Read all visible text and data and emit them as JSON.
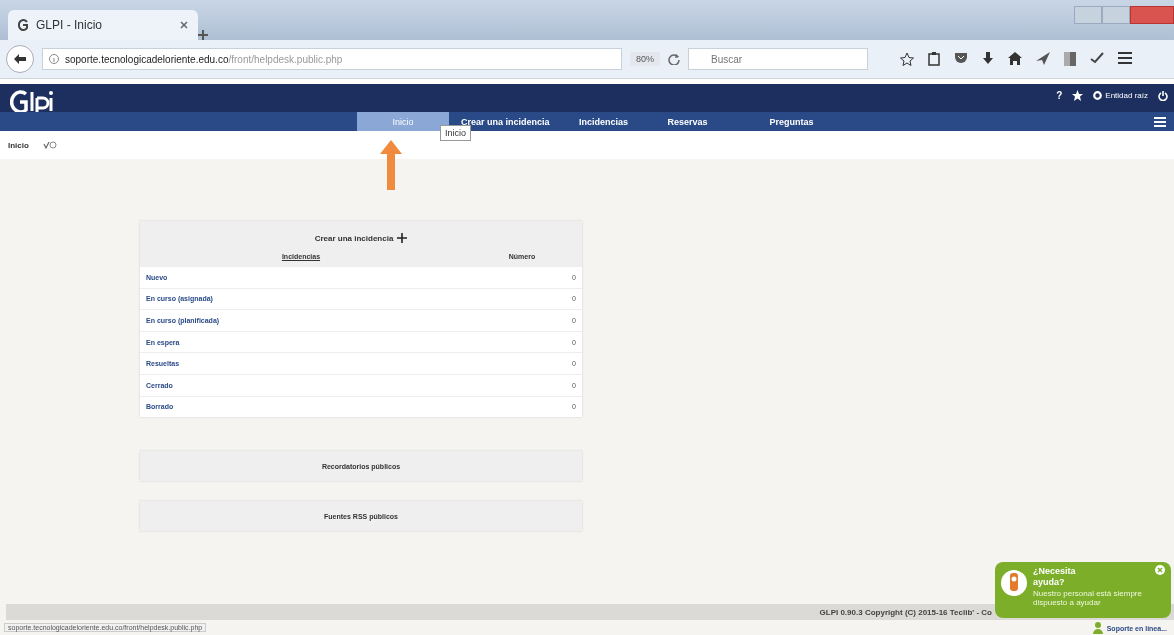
{
  "browser": {
    "tab_title": "GLPI - Inicio",
    "address": {
      "host": "soporte.tecnologicadeloriente.edu.co",
      "path": "/front/helpdesk.public.php"
    },
    "zoom": "80%",
    "search": {
      "placeholder": "Buscar"
    }
  },
  "header": {
    "help": "?",
    "entity": "Entidad raíz"
  },
  "nav": [
    {
      "label": "Inicio",
      "selected": true
    },
    {
      "label": "Crear una incidencia",
      "selected": false
    },
    {
      "label": "Incidencias",
      "selected": false
    },
    {
      "label": "Reservas",
      "selected": false
    },
    {
      "label": "Preguntas",
      "selected": false
    }
  ],
  "breadcrumb": "Inicio",
  "tooltip": "Inicio",
  "incidents_panel": {
    "title": "Crear una incidencia",
    "columns": [
      "Incidencias",
      "Número"
    ],
    "rows": [
      {
        "status": "Nuevo",
        "count": "0"
      },
      {
        "status": "En curso (asignada)",
        "count": "0"
      },
      {
        "status": "En curso (planificada)",
        "count": "0"
      },
      {
        "status": "En espera",
        "count": "0"
      },
      {
        "status": "Resueltas",
        "count": "0"
      },
      {
        "status": "Cerrado",
        "count": "0"
      },
      {
        "status": "Borrado",
        "count": "0"
      }
    ]
  },
  "panels": [
    "Recordatorios públicos",
    "Fuentes RSS públicos"
  ],
  "footer": "GLPI 0.90.3 Copyright (C) 2015-16 Teclib' - Co",
  "status_url": "soporte.tecnologicadeloriente.edu.co/front/helpdesk.public.php",
  "chat": {
    "title": "¿Necesita ayuda?",
    "message": "Nuestro personal está siempre dispuesto a ayudar",
    "button": "Soporte en línea..."
  }
}
